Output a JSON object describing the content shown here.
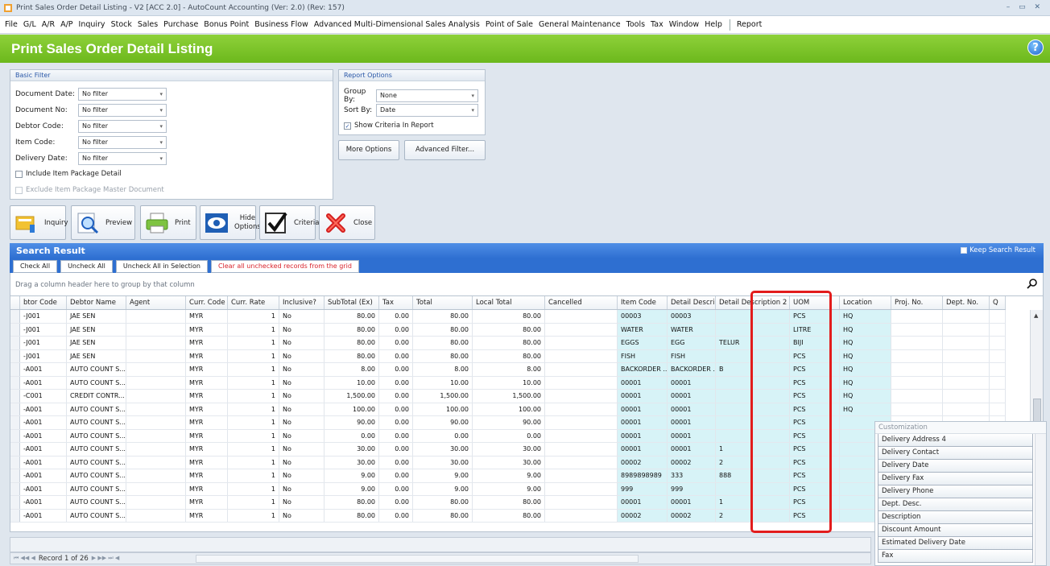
{
  "window": {
    "title": "Print Sales Order Detail Listing - V2 [ACC 2.0] - AutoCount Accounting (Ver: 2.0) (Rev: 157)",
    "controls": "– ▭ ✕"
  },
  "menu": [
    "File",
    "G/L",
    "A/R",
    "A/P",
    "Inquiry",
    "Stock",
    "Sales",
    "Purchase",
    "Bonus Point",
    "Business Flow",
    "Advanced Multi-Dimensional Sales Analysis",
    "Point of Sale",
    "General Maintenance",
    "Tools",
    "Tax",
    "Window",
    "Help"
  ],
  "menu_report": "Report",
  "page_title": "Print Sales Order Detail Listing",
  "help_label": "?",
  "basic_filter": {
    "title": "Basic Filter",
    "fields": [
      {
        "label": "Document Date:",
        "value": "No filter"
      },
      {
        "label": "Document No:",
        "value": "No filter"
      },
      {
        "label": "Debtor Code:",
        "value": "No filter"
      },
      {
        "label": "Item Code:",
        "value": "No filter"
      },
      {
        "label": "Delivery Date:",
        "value": "No filter"
      }
    ],
    "include_pkg": "Include Item Package Detail",
    "exclude_pkg": "Exclude Item Package Master Document"
  },
  "report_options": {
    "title": "Report Options",
    "group_by_label": "Group By:",
    "group_by_value": "None",
    "sort_by_label": "Sort By:",
    "sort_by_value": "Date",
    "show_criteria": "Show Criteria In Report",
    "more_options": "More Options",
    "advanced_filter": "Advanced Filter..."
  },
  "toolbar": {
    "inquiry": "Inquiry",
    "preview": "Preview",
    "print": "Print",
    "hide_options_1": "Hide",
    "hide_options_2": "Options",
    "criteria": "Criteria",
    "close": "Close"
  },
  "search": {
    "title": "Search Result",
    "keep_result": "Keep Search Result",
    "check_all": "Check All",
    "uncheck_all": "Uncheck All",
    "uncheck_sel": "Uncheck All in Selection",
    "clear_unchecked": "Clear all unchecked records from the grid",
    "group_hint": "Drag a column header here to group by that column"
  },
  "grid": {
    "columns": [
      "",
      "btor Code",
      "Debtor Name",
      "Agent",
      "Curr. Code",
      "Curr. Rate",
      "Inclusive?",
      "SubTotal (Ex)",
      "Tax",
      "Total",
      "Local Total",
      "Cancelled",
      "Item Code",
      "Detail Descri...",
      "Detail Description 2",
      "UOM",
      "Location",
      "Proj. No.",
      "Dept. No.",
      "Q"
    ],
    "rows": [
      [
        "-J001",
        "JAE SEN",
        "",
        "MYR",
        "1",
        "No",
        "80.00",
        "0.00",
        "80.00",
        "80.00",
        "",
        "00003",
        "00003",
        "",
        "PCS",
        "HQ"
      ],
      [
        "-J001",
        "JAE SEN",
        "",
        "MYR",
        "1",
        "No",
        "80.00",
        "0.00",
        "80.00",
        "80.00",
        "",
        "WATER",
        "WATER",
        "",
        "LITRE",
        "HQ"
      ],
      [
        "-J001",
        "JAE SEN",
        "",
        "MYR",
        "1",
        "No",
        "80.00",
        "0.00",
        "80.00",
        "80.00",
        "",
        "EGGS",
        "EGG",
        "TELUR",
        "BIJI",
        "HQ"
      ],
      [
        "-J001",
        "JAE SEN",
        "",
        "MYR",
        "1",
        "No",
        "80.00",
        "0.00",
        "80.00",
        "80.00",
        "",
        "FISH",
        "FISH",
        "",
        "PCS",
        "HQ"
      ],
      [
        "-A001",
        "AUTO COUNT S...",
        "",
        "MYR",
        "1",
        "No",
        "8.00",
        "0.00",
        "8.00",
        "8.00",
        "",
        "BACKORDER ...",
        "BACKORDER ...",
        "B",
        "PCS",
        "HQ"
      ],
      [
        "-A001",
        "AUTO COUNT S...",
        "",
        "MYR",
        "1",
        "No",
        "10.00",
        "0.00",
        "10.00",
        "10.00",
        "",
        "00001",
        "00001",
        "",
        "PCS",
        "HQ"
      ],
      [
        "-C001",
        "CREDIT CONTR...",
        "",
        "MYR",
        "1",
        "No",
        "1,500.00",
        "0.00",
        "1,500.00",
        "1,500.00",
        "",
        "00001",
        "00001",
        "",
        "PCS",
        "HQ"
      ],
      [
        "-A001",
        "AUTO COUNT S...",
        "",
        "MYR",
        "1",
        "No",
        "100.00",
        "0.00",
        "100.00",
        "100.00",
        "",
        "00001",
        "00001",
        "",
        "PCS",
        "HQ"
      ],
      [
        "-A001",
        "AUTO COUNT S...",
        "",
        "MYR",
        "1",
        "No",
        "90.00",
        "0.00",
        "90.00",
        "90.00",
        "",
        "00001",
        "00001",
        "",
        "PCS",
        ""
      ],
      [
        "-A001",
        "AUTO COUNT S...",
        "",
        "MYR",
        "1",
        "No",
        "0.00",
        "0.00",
        "0.00",
        "0.00",
        "",
        "00001",
        "00001",
        "",
        "PCS",
        ""
      ],
      [
        "-A001",
        "AUTO COUNT S...",
        "",
        "MYR",
        "1",
        "No",
        "30.00",
        "0.00",
        "30.00",
        "30.00",
        "",
        "00001",
        "00001",
        "1",
        "PCS",
        ""
      ],
      [
        "-A001",
        "AUTO COUNT S...",
        "",
        "MYR",
        "1",
        "No",
        "30.00",
        "0.00",
        "30.00",
        "30.00",
        "",
        "00002",
        "00002",
        "2",
        "PCS",
        ""
      ],
      [
        "-A001",
        "AUTO COUNT S...",
        "",
        "MYR",
        "1",
        "No",
        "9.00",
        "0.00",
        "9.00",
        "9.00",
        "",
        "8989898989",
        "333",
        "888",
        "PCS",
        ""
      ],
      [
        "-A001",
        "AUTO COUNT S...",
        "",
        "MYR",
        "1",
        "No",
        "9.00",
        "0.00",
        "9.00",
        "9.00",
        "",
        "999",
        "999",
        "",
        "PCS",
        ""
      ],
      [
        "-A001",
        "AUTO COUNT S...",
        "",
        "MYR",
        "1",
        "No",
        "80.00",
        "0.00",
        "80.00",
        "80.00",
        "",
        "00001",
        "00001",
        "1",
        "PCS",
        ""
      ],
      [
        "-A001",
        "AUTO COUNT S...",
        "",
        "MYR",
        "1",
        "No",
        "80.00",
        "0.00",
        "80.00",
        "80.00",
        "",
        "00002",
        "00002",
        "2",
        "PCS",
        ""
      ]
    ]
  },
  "customization": {
    "title": "Customization",
    "items": [
      "Delivery Address 4",
      "Delivery Contact",
      "Delivery Date",
      "Delivery Fax",
      "Delivery Phone",
      "Dept. Desc.",
      "Description",
      "Discount Amount",
      "Estimated Delivery Date",
      "Fax"
    ]
  },
  "status": {
    "record": "Record 1 of 26",
    "nav_first": "⏮ ◀◀ ◀",
    "nav_last": "▶ ▶▶ ⏭ ◀"
  }
}
